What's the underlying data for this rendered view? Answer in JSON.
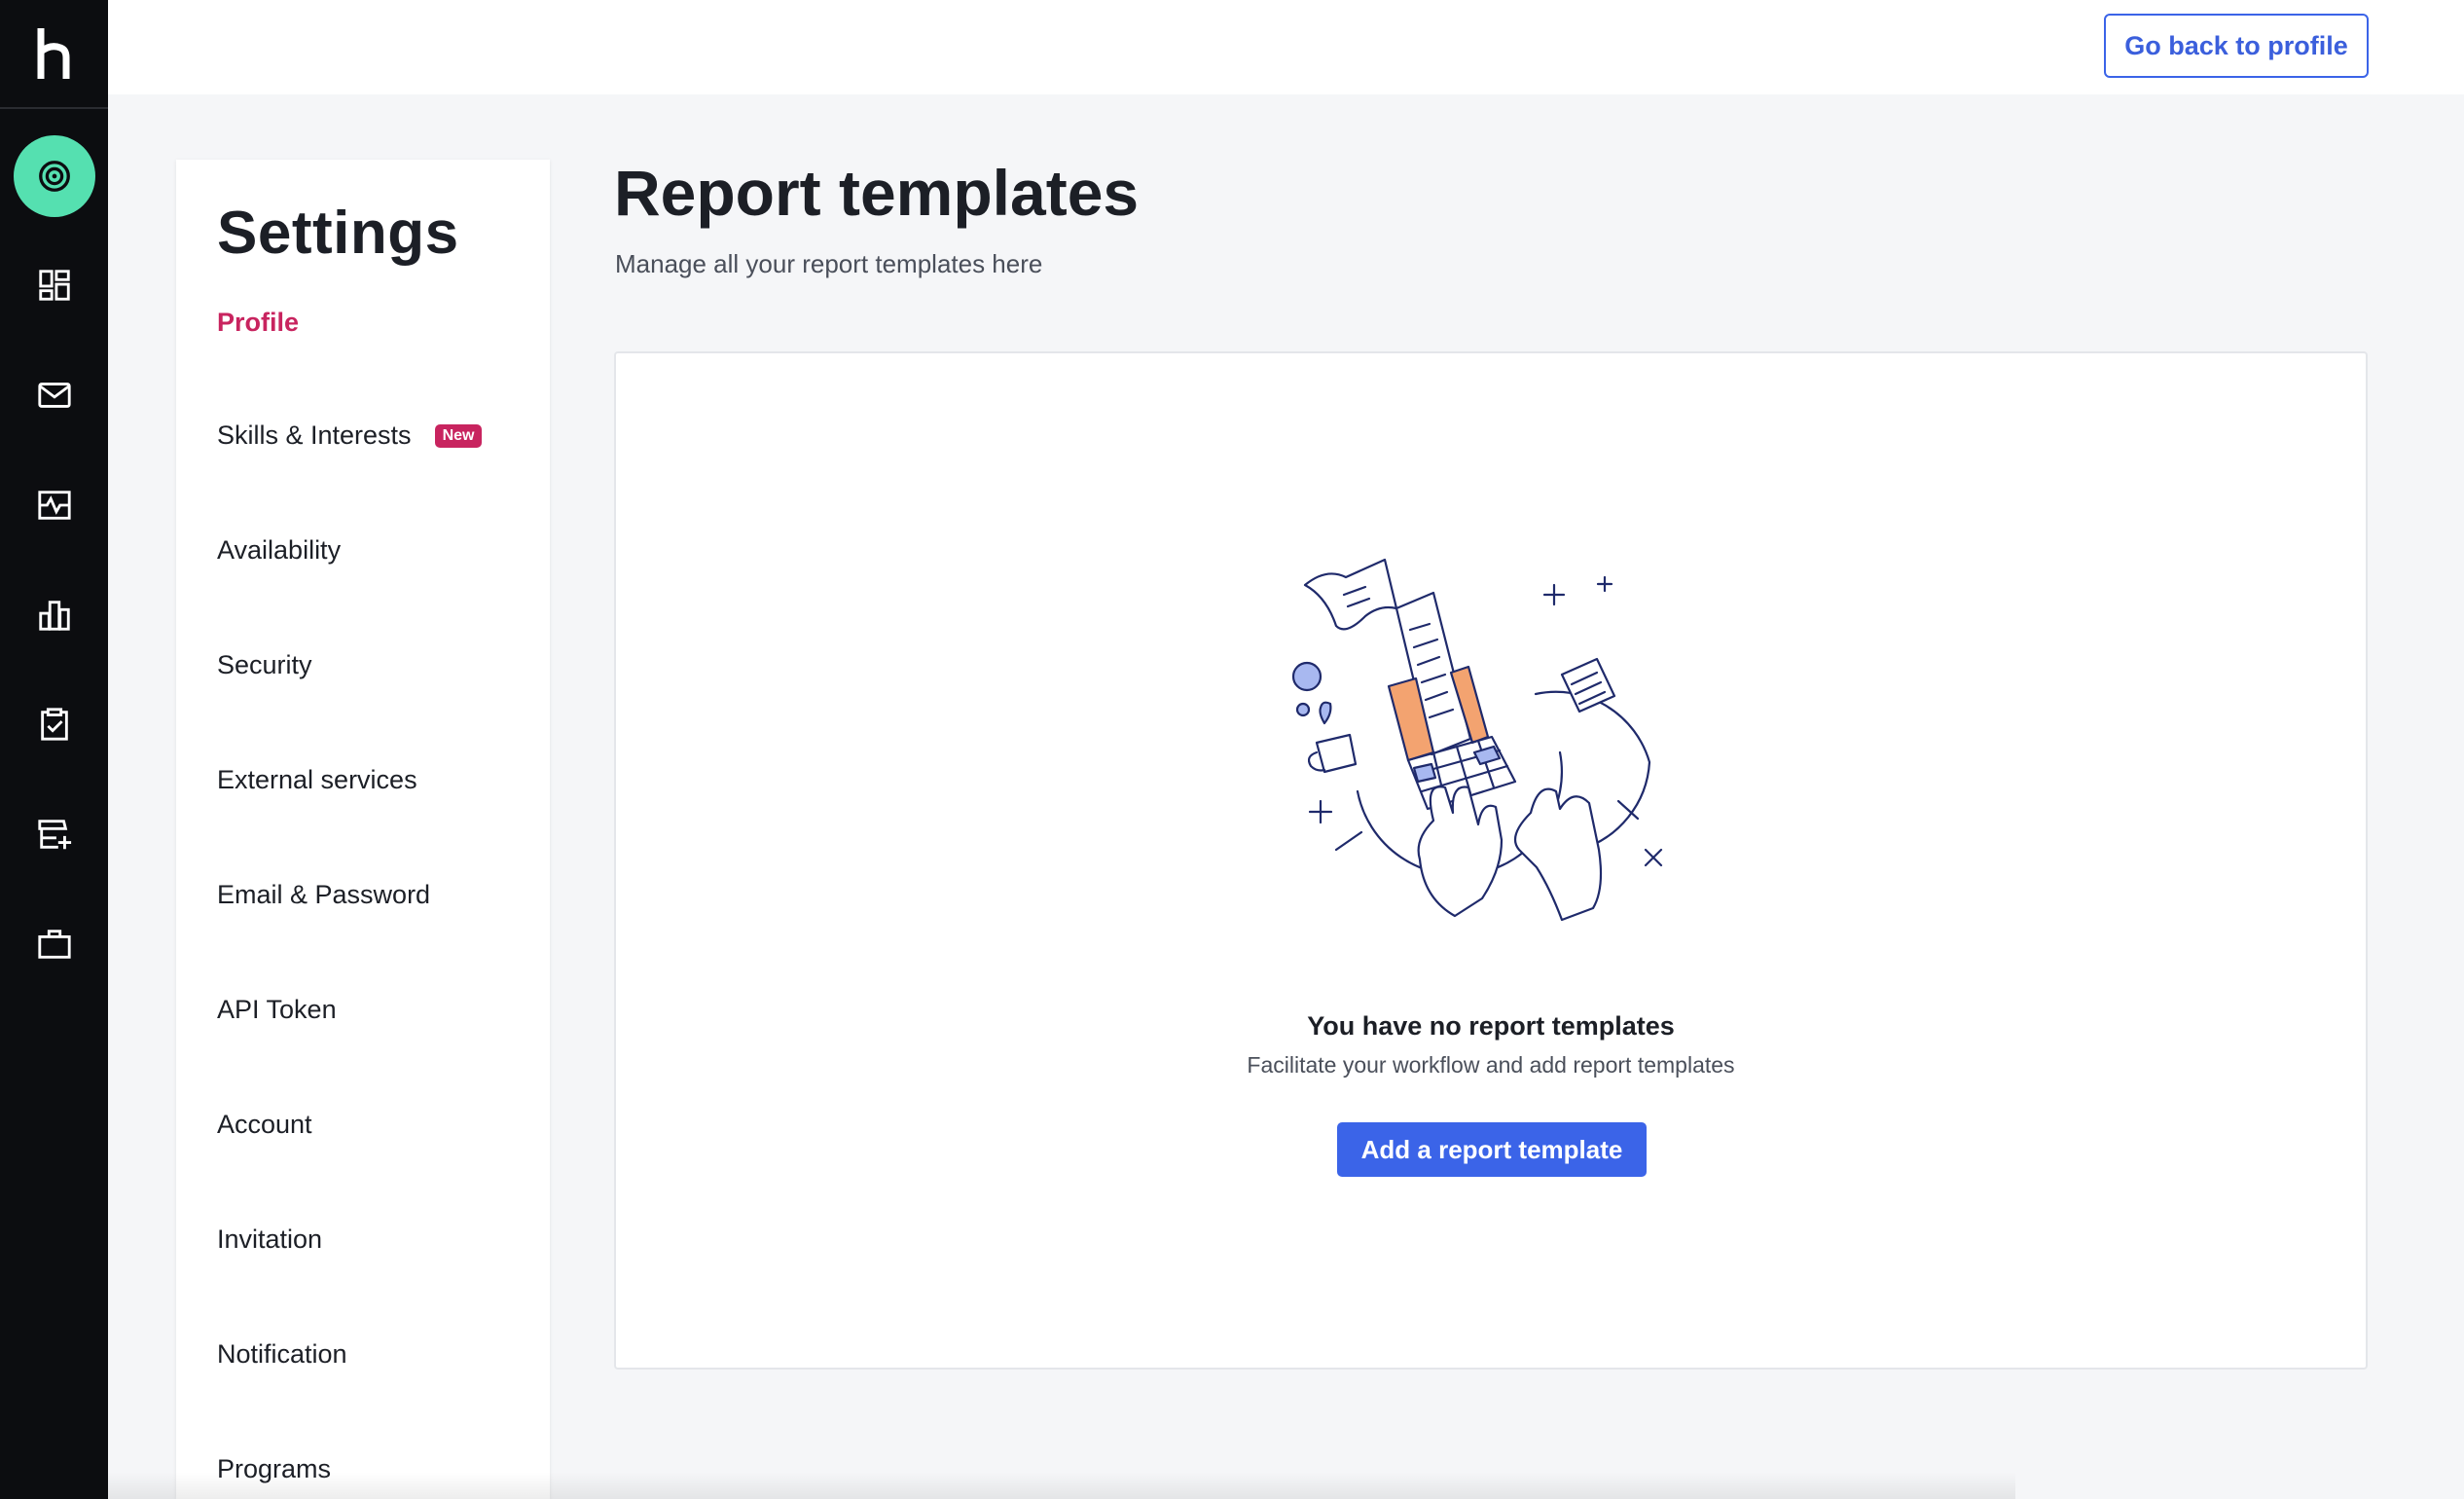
{
  "rail": {
    "items": [
      {
        "icon": "target-icon",
        "active": true
      },
      {
        "icon": "dashboard-icon"
      },
      {
        "icon": "mail-icon"
      },
      {
        "icon": "activity-icon"
      },
      {
        "icon": "bar-chart-icon"
      },
      {
        "icon": "clipboard-check-icon"
      },
      {
        "icon": "store-add-icon"
      },
      {
        "icon": "briefcase-icon"
      }
    ]
  },
  "topbar": {
    "back_label": "Go back to profile"
  },
  "settings": {
    "title": "Settings",
    "items": [
      {
        "label": "Profile",
        "active": true
      },
      {
        "label": "Skills & Interests",
        "badge": "New"
      },
      {
        "label": "Availability"
      },
      {
        "label": "Security"
      },
      {
        "label": "External services"
      },
      {
        "label": "Email & Password"
      },
      {
        "label": "API Token"
      },
      {
        "label": "Account"
      },
      {
        "label": "Invitation"
      },
      {
        "label": "Notification"
      },
      {
        "label": "Programs"
      }
    ]
  },
  "main": {
    "title": "Report templates",
    "subtitle": "Manage all your report templates here",
    "empty_state": {
      "title": "You have no report templates",
      "subtitle": "Facilitate your workflow and add report templates",
      "button_label": "Add a report template"
    }
  },
  "colors": {
    "accent": "#3b64e8",
    "brand_pink": "#c8245f",
    "rail_bg": "#0c0d10",
    "active_green": "#55e0b0"
  }
}
